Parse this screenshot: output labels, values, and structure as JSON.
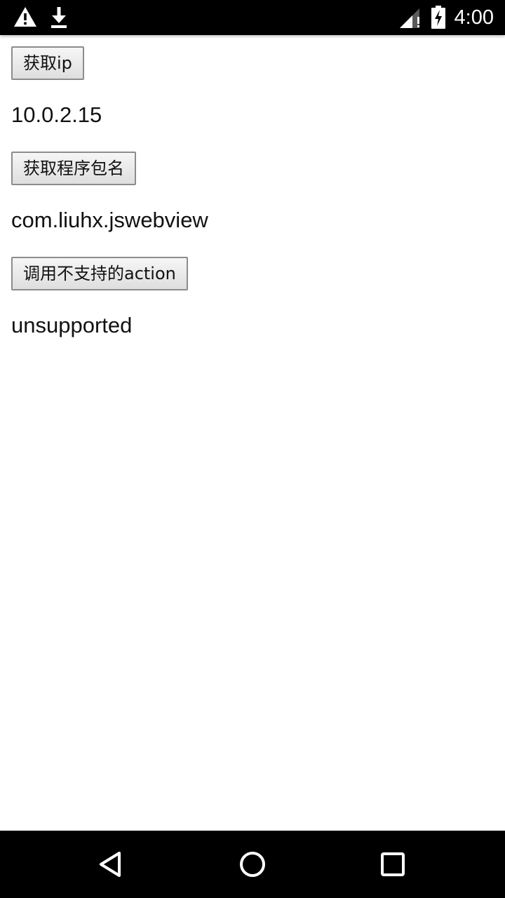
{
  "status_bar": {
    "time": "4:00",
    "icons": [
      "warning-icon",
      "download-icon",
      "signal-icon",
      "battery-charging-icon"
    ]
  },
  "page": {
    "get_ip_button": "获取ip",
    "ip_result": "10.0.2.15",
    "get_package_button": "获取程序包名",
    "package_result": "com.liuhx.jswebview",
    "unsupported_action_button": "调用不支持的action",
    "unsupported_result": "unsupported"
  },
  "nav_bar": {
    "icons": [
      "back-icon",
      "home-icon",
      "recents-icon"
    ]
  }
}
